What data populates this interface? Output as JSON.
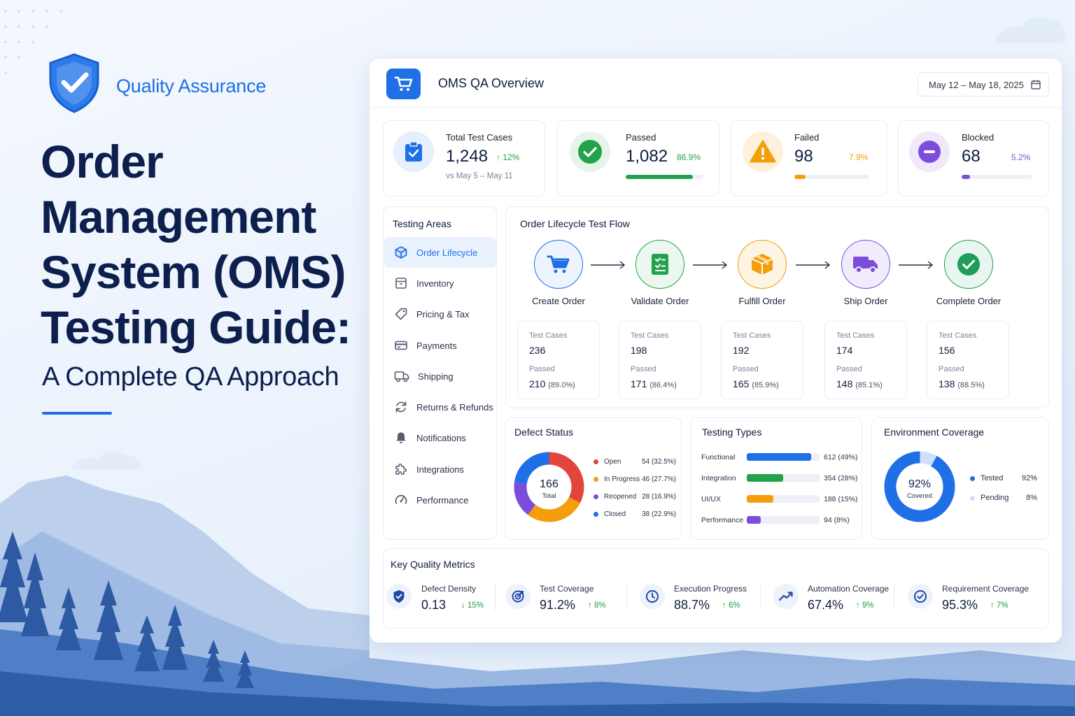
{
  "brand": {
    "label": "Quality Assurance"
  },
  "hero": {
    "title_lines": [
      "Order",
      "Management",
      "System (OMS)",
      "Testing Guide:"
    ],
    "subtitle": "A Complete QA Approach"
  },
  "colors": {
    "primary": "#1f6fe6",
    "success": "#22a24a",
    "warning": "#f59e0b",
    "blocked": "#7c4ddc",
    "danger": "#e2453c",
    "navy": "#0d1f4d"
  },
  "dashboard": {
    "title": "OMS QA Overview",
    "date_range": "May 12 – May 18, 2025",
    "stats": {
      "total": {
        "label": "Total Test Cases",
        "value": "1,248",
        "delta": "↑ 12%",
        "note": "vs May 5 – May 11",
        "icon": "clipboard-check-icon"
      },
      "passed": {
        "label": "Passed",
        "value": "1,082",
        "pct": "86.9%",
        "fraction": 0.869,
        "icon": "check-circle-icon"
      },
      "failed": {
        "label": "Failed",
        "value": "98",
        "pct": "7.9%",
        "fraction": 0.079,
        "icon": "warning-icon"
      },
      "blocked": {
        "label": "Blocked",
        "value": "68",
        "pct": "5.2%",
        "fraction": 0.052,
        "icon": "minus-circle-icon"
      }
    },
    "testing_areas": {
      "title": "Testing Areas",
      "items": [
        {
          "label": "Order Lifecycle",
          "icon": "cube-icon",
          "active": true
        },
        {
          "label": "Inventory",
          "icon": "box-icon"
        },
        {
          "label": "Pricing & Tax",
          "icon": "tag-icon"
        },
        {
          "label": "Payments",
          "icon": "credit-card-icon"
        },
        {
          "label": "Shipping",
          "icon": "truck-icon"
        },
        {
          "label": "Returns & Refunds",
          "icon": "refresh-icon"
        },
        {
          "label": "Notifications",
          "icon": "bell-icon"
        },
        {
          "label": "Integrations",
          "icon": "puzzle-icon"
        },
        {
          "label": "Performance",
          "icon": "gauge-icon"
        }
      ]
    },
    "flow": {
      "title": "Order Lifecycle Test Flow",
      "case_label": "Test Cases",
      "passed_label": "Passed",
      "steps": [
        {
          "label": "Create Order",
          "icon": "cart-icon",
          "cases": "236",
          "passed": "210",
          "pct": "(89.0%)"
        },
        {
          "label": "Validate Order",
          "icon": "checklist-icon",
          "cases": "198",
          "passed": "171",
          "pct": "(86.4%)"
        },
        {
          "label": "Fulfill Order",
          "icon": "package-icon",
          "cases": "192",
          "passed": "165",
          "pct": "(85.9%)"
        },
        {
          "label": "Ship Order",
          "icon": "truck-icon",
          "cases": "174",
          "passed": "148",
          "pct": "(85.1%)"
        },
        {
          "label": "Complete Order",
          "icon": "check-circle-icon",
          "cases": "156",
          "passed": "138",
          "pct": "(88.5%)"
        }
      ]
    },
    "defects": {
      "title": "Defect Status",
      "total": "166",
      "total_label": "Total",
      "items": [
        {
          "label": "Open",
          "value": 54,
          "display": "54 (32.5%)",
          "color": "#e2453c"
        },
        {
          "label": "In Progress",
          "value": 46,
          "display": "46 (27.7%)",
          "color": "#f59e0b"
        },
        {
          "label": "Reopened",
          "value": 28,
          "display": "28 (16.9%)",
          "color": "#7c4ddc"
        },
        {
          "label": "Closed",
          "value": 38,
          "display": "38 (22.9%)",
          "color": "#1f6fe6"
        }
      ]
    },
    "testing_types": {
      "title": "Testing Types",
      "items": [
        {
          "label": "Functional",
          "fraction": 0.49,
          "display": "612 (49%)",
          "color": "#1f6fe6"
        },
        {
          "label": "Integration",
          "fraction": 0.28,
          "display": "354 (28%)",
          "color": "#22a24a"
        },
        {
          "label": "UI/UX",
          "fraction": 0.15,
          "display": "188 (15%)",
          "color": "#f59e0b"
        },
        {
          "label": "Performance",
          "fraction": 0.08,
          "display": "94 (8%)",
          "color": "#7c4ddc"
        }
      ]
    },
    "environment": {
      "title": "Environment Coverage",
      "center_value": "92%",
      "center_label": "Covered",
      "items": [
        {
          "label": "Tested",
          "value": "92%",
          "fraction": 0.92,
          "color": "#1f6fe6"
        },
        {
          "label": "Pending",
          "value": "8%",
          "fraction": 0.08,
          "color": "#cfe0fa"
        }
      ]
    },
    "metrics": {
      "title": "Key Quality Metrics",
      "items": [
        {
          "label": "Defect Density",
          "value": "0.13",
          "delta": "↓ 15%",
          "icon": "shield-icon"
        },
        {
          "label": "Test Coverage",
          "value": "91.2%",
          "delta": "↑ 8%",
          "icon": "target-icon"
        },
        {
          "label": "Execution Progress",
          "value": "88.7%",
          "delta": "↑ 6%",
          "icon": "clock-icon"
        },
        {
          "label": "Automation Coverage",
          "value": "67.4%",
          "delta": "↑ 9%",
          "icon": "trend-up-icon"
        },
        {
          "label": "Requirement Coverage",
          "value": "95.3%",
          "delta": "↑ 7%",
          "icon": "check-badge-icon"
        }
      ]
    }
  }
}
